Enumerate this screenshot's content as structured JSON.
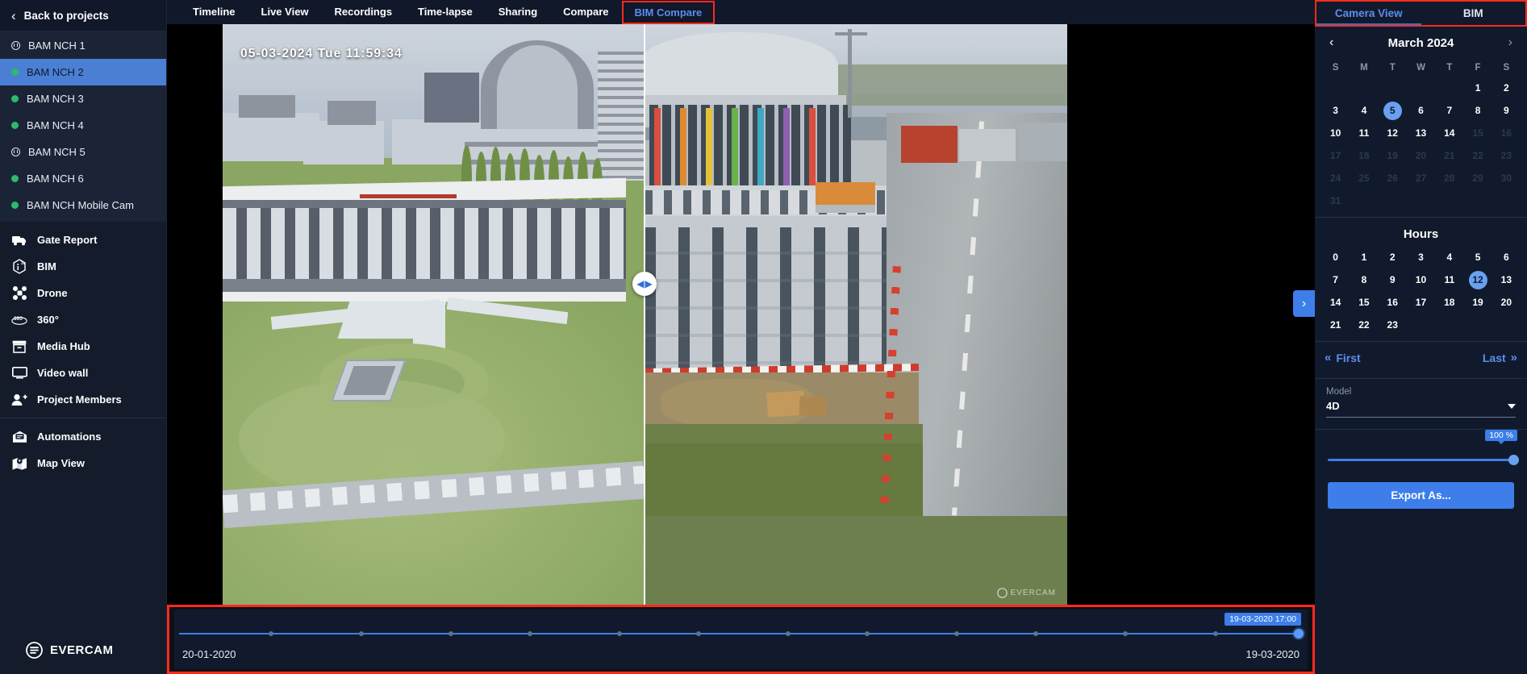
{
  "sidebar": {
    "back_label": "Back to projects",
    "cameras": [
      {
        "label": "BAM NCH 1",
        "status": "paused",
        "active": false
      },
      {
        "label": "BAM NCH 2",
        "status": "online",
        "active": true
      },
      {
        "label": "BAM NCH 3",
        "status": "online",
        "active": false
      },
      {
        "label": "BAM NCH 4",
        "status": "online",
        "active": false
      },
      {
        "label": "BAM NCH 5",
        "status": "paused",
        "active": false
      },
      {
        "label": "BAM NCH 6",
        "status": "online",
        "active": false
      },
      {
        "label": "BAM NCH Mobile Cam",
        "status": "online",
        "active": false
      }
    ],
    "nav_group_1": [
      {
        "label": "Gate Report",
        "icon": "truck-icon"
      },
      {
        "label": "BIM",
        "icon": "bim-icon"
      },
      {
        "label": "Drone",
        "icon": "drone-icon"
      },
      {
        "label": "360°",
        "icon": "threesixty-icon"
      },
      {
        "label": "Media Hub",
        "icon": "media-hub-icon"
      },
      {
        "label": "Video wall",
        "icon": "video-wall-icon"
      },
      {
        "label": "Project Members",
        "icon": "project-members-icon"
      }
    ],
    "nav_group_2": [
      {
        "label": "Automations",
        "icon": "automations-icon"
      },
      {
        "label": "Map View",
        "icon": "map-view-icon"
      }
    ],
    "brand": "EVERCAM"
  },
  "topbar": {
    "tabs": [
      {
        "label": "Timeline",
        "active": false,
        "highlighted": false
      },
      {
        "label": "Live View",
        "active": false,
        "highlighted": false
      },
      {
        "label": "Recordings",
        "active": false,
        "highlighted": false
      },
      {
        "label": "Time-lapse",
        "active": false,
        "highlighted": false
      },
      {
        "label": "Sharing",
        "active": false,
        "highlighted": false
      },
      {
        "label": "Compare",
        "active": false,
        "highlighted": false
      },
      {
        "label": "BIM Compare",
        "active": true,
        "highlighted": true
      }
    ]
  },
  "viewer": {
    "timestamp": "05-03-2024 Tue 11:59:34",
    "watermark": "EVERCAM",
    "next_label": "›",
    "split_left_glyph": "◀",
    "split_right_glyph": "▶"
  },
  "timeline": {
    "start_date": "20-01-2020",
    "end_date": "19-03-2020",
    "tooltip": "19-03-2020 17:00",
    "position_percent": 99.2
  },
  "right_panel": {
    "tabs": [
      {
        "label": "Camera View",
        "active": true
      },
      {
        "label": "BIM",
        "active": false
      }
    ],
    "calendar": {
      "month_label": "March 2024",
      "prev_glyph": "‹",
      "next_glyph": "›",
      "dow": [
        "S",
        "M",
        "T",
        "W",
        "T",
        "F",
        "S"
      ],
      "lead_blanks": 5,
      "days": [
        {
          "n": 1,
          "state": "on"
        },
        {
          "n": 2,
          "state": "on"
        },
        {
          "n": 3,
          "state": "on"
        },
        {
          "n": 4,
          "state": "on"
        },
        {
          "n": 5,
          "state": "selected"
        },
        {
          "n": 6,
          "state": "on"
        },
        {
          "n": 7,
          "state": "on"
        },
        {
          "n": 8,
          "state": "on"
        },
        {
          "n": 9,
          "state": "on"
        },
        {
          "n": 10,
          "state": "on"
        },
        {
          "n": 11,
          "state": "on"
        },
        {
          "n": 12,
          "state": "on"
        },
        {
          "n": 13,
          "state": "on"
        },
        {
          "n": 14,
          "state": "on"
        },
        {
          "n": 15,
          "state": "off"
        },
        {
          "n": 16,
          "state": "off"
        },
        {
          "n": 17,
          "state": "off"
        },
        {
          "n": 18,
          "state": "off"
        },
        {
          "n": 19,
          "state": "off"
        },
        {
          "n": 20,
          "state": "off"
        },
        {
          "n": 21,
          "state": "off"
        },
        {
          "n": 22,
          "state": "off"
        },
        {
          "n": 23,
          "state": "off"
        },
        {
          "n": 24,
          "state": "off"
        },
        {
          "n": 25,
          "state": "off"
        },
        {
          "n": 26,
          "state": "off"
        },
        {
          "n": 27,
          "state": "off"
        },
        {
          "n": 28,
          "state": "off"
        },
        {
          "n": 29,
          "state": "off"
        },
        {
          "n": 30,
          "state": "off"
        },
        {
          "n": 31,
          "state": "off"
        }
      ]
    },
    "hours": {
      "title": "Hours",
      "values": [
        0,
        1,
        2,
        3,
        4,
        5,
        6,
        7,
        8,
        9,
        10,
        11,
        12,
        13,
        14,
        15,
        16,
        17,
        18,
        19,
        20,
        21,
        22,
        23
      ],
      "selected": 12
    },
    "first_last": {
      "first_label": "First",
      "last_label": "Last",
      "first_glyph": "«",
      "last_glyph": "»"
    },
    "model": {
      "label": "Model",
      "value": "4D"
    },
    "opacity": {
      "value_label": "100 %",
      "percent": 100
    },
    "export_label": "Export As..."
  },
  "colors": {
    "accent": "#3d7eea",
    "highlight_box": "#ff2a1c",
    "online": "#2eb872",
    "selected_day": "#6aa0f0",
    "sidebar_active": "#4a7fd4"
  }
}
